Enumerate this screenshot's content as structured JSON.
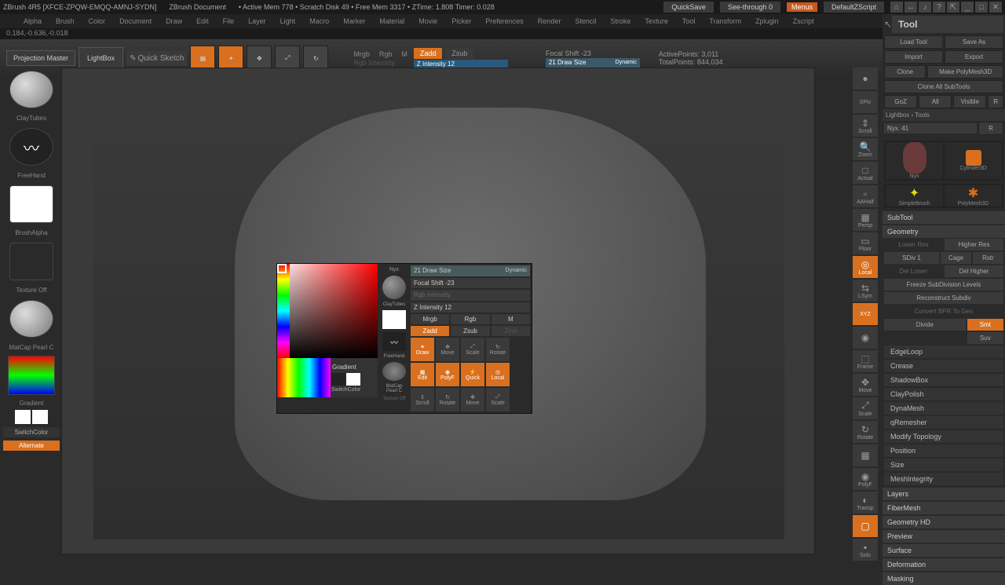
{
  "titlebar": {
    "app": "ZBrush 4R5 [XFCE-ZPQW-EMQQ-AMNJ-SYDN]",
    "doc": "ZBrush Document",
    "mem": "• Active Mem 778 • Scratch Disk 49 • Free Mem 3317 • ZTime: 1.808 Timer: 0.028",
    "quicksave": "QuickSave",
    "seethrough": "See-through 0",
    "menus": "Menus",
    "default": "DefaultZScript"
  },
  "menubar": [
    "",
    "Alpha",
    "Brush",
    "Color",
    "Document",
    "Draw",
    "Edit",
    "File",
    "Layer",
    "Light",
    "Macro",
    "Marker",
    "Material",
    "Movie",
    "Picker",
    "Preferences",
    "Render",
    "Stencil",
    "Stroke",
    "Texture",
    "Tool",
    "Transform",
    "Zplugin",
    "Zscript"
  ],
  "status": "0.184,-0.636,-0.018",
  "toolbar": {
    "projection": "Projection\nMaster",
    "lightbox": "LightBox",
    "quicksketch": "Quick\nSketch",
    "mrgb": "Mrgb",
    "rgb": "Rgb",
    "m": "M",
    "zadd": "Zadd",
    "zsub": "Zsub",
    "rgbintensity": "Rgb Intensity",
    "zintensity": "Z Intensity 12",
    "focalshift": "Focal Shift -23",
    "drawsize": "21 Draw Size",
    "dynamic": "Dynamic",
    "activepoints": "ActivePoints: 3,011",
    "totalpoints": "TotalPoints: 844,034"
  },
  "left": {
    "claytube": "ClayTubes",
    "freehand": "FreeHand",
    "brushalpha": "BrushAlpha",
    "textureoff": "Texture Off",
    "matcap": "MatCap Pearl C",
    "gradient": "Gradient",
    "switchcolor": "SwitchColor",
    "alternate": "Alternate"
  },
  "popup": {
    "nyx": "Nyx",
    "claytubes": "ClayTubes",
    "freehand": "FreeHand",
    "matcap": "MatCap Pearl C",
    "textureoff": "Texture Off",
    "gradient": "Gradient",
    "switchcolor": "SwitchColor",
    "drawsize": "21 Draw Size",
    "focalshift": "Focal Shift -23",
    "rgbintensity": "Rgb Intensity",
    "zintensity": "Z Intensity 12",
    "dynamic": "Dynamic",
    "mrgb": "Mrgb",
    "rgb": "Rgb",
    "m": "M",
    "zadd": "Zadd",
    "zsub": "Zsub",
    "zcut": "Zcut",
    "icons": [
      "Draw",
      "Move",
      "Scale",
      "Rotate",
      "Edit",
      "PolyF",
      "Quick",
      "Local",
      "Scroll",
      "Rotate",
      "Move",
      "Scale"
    ]
  },
  "rightstrip": [
    "",
    "SPix",
    "Scroll",
    "Zoom",
    "Actual",
    "AAHalf",
    "Persp",
    "Floor",
    "Local",
    "LSym",
    "XYZ",
    "",
    "Frame",
    "Move",
    "Scale",
    "Rotate",
    "",
    "PolyF",
    "Transp",
    "",
    "Solo"
  ],
  "rightpanel": {
    "tool": "Tool",
    "loadtool": "Load Tool",
    "saveas": "Save As",
    "import": "Import",
    "export": "Export",
    "clone": "Clone",
    "makepolymesh": "Make PolyMesh3D",
    "cloneall": "Clone All SubTools",
    "goz": "GoZ",
    "all": "All",
    "visible": "Visible",
    "r": "R",
    "lightboxtools": "Lightbox › Tools",
    "nyx": "Nyx. 41",
    "previews": [
      "Nyx",
      "Cylinder3D",
      "",
      "PolyMesh3D",
      "SimpleBrush",
      ""
    ],
    "subtool": "SubTool",
    "geometry": "Geometry",
    "lowerres": "Lower Res",
    "higherres": "Higher Res",
    "sdiv": "SDiv 1",
    "cage": "Cage",
    "rstr": "Rstr",
    "dellower": "Del Lower",
    "delhigher": "Del Higher",
    "freeze": "Freeze SubDivision Levels",
    "reconstruct": "Reconstruct Subdiv",
    "convertbpr": "Convert BPR To Geo",
    "divide": "Divide",
    "smt": "Smt",
    "suv": "Suv",
    "sections": [
      "EdgeLoop",
      "Crease",
      "ShadowBox",
      "ClayPolish",
      "DynaMesh",
      "qRemesher",
      "Modify Topology",
      "Position",
      "Size",
      "MeshIntegrity"
    ],
    "bottom": [
      "Layers",
      "FiberMesh",
      "Geometry HD",
      "Preview",
      "Surface",
      "Deformation",
      "Masking"
    ]
  }
}
